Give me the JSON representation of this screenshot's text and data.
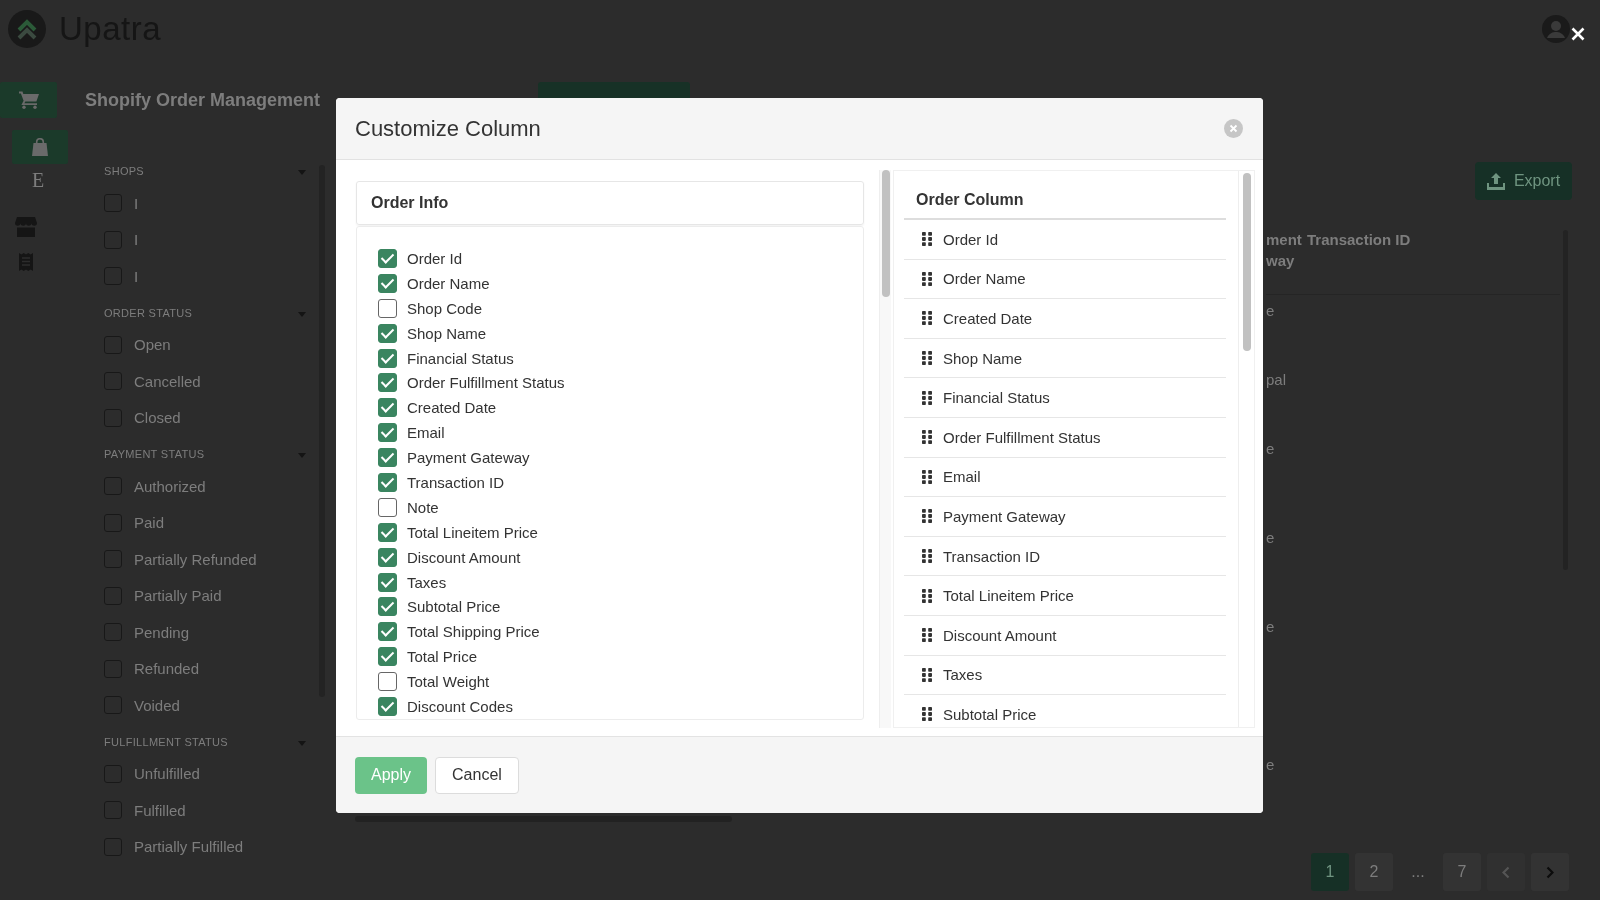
{
  "app": {
    "name": "Upatra"
  },
  "rail": [
    {
      "selected": true
    },
    {
      "selected": true
    },
    {
      "label": "E",
      "selected": false
    },
    {
      "selected": false
    },
    {
      "selected": false
    }
  ],
  "page": {
    "title": "Shopify Order Management",
    "export_button": "Export"
  },
  "filters": [
    {
      "heading": "SHOPS",
      "expanded": true,
      "options": [
        {
          "label": "I",
          "checked": false
        },
        {
          "label": "I",
          "checked": false
        },
        {
          "label": "I",
          "checked": false
        }
      ]
    },
    {
      "heading": "ORDER STATUS",
      "expanded": true,
      "options": [
        {
          "label": "Open",
          "checked": false
        },
        {
          "label": "Cancelled",
          "checked": false
        },
        {
          "label": "Closed",
          "checked": false
        }
      ]
    },
    {
      "heading": "PAYMENT STATUS",
      "expanded": true,
      "options": [
        {
          "label": "Authorized",
          "checked": false
        },
        {
          "label": "Paid",
          "checked": false
        },
        {
          "label": "Partially Refunded",
          "checked": false
        },
        {
          "label": "Partially Paid",
          "checked": false
        },
        {
          "label": "Pending",
          "checked": false
        },
        {
          "label": "Refunded",
          "checked": false
        },
        {
          "label": "Voided",
          "checked": false
        }
      ]
    },
    {
      "heading": "FULFILLMENT STATUS",
      "expanded": true,
      "options": [
        {
          "label": "Unfulfilled",
          "checked": false
        },
        {
          "label": "Fulfilled",
          "checked": false
        },
        {
          "label": "Partially Fulfilled",
          "checked": false
        }
      ]
    }
  ],
  "table": {
    "columns": [
      {
        "header": [
          "ment",
          "way"
        ]
      },
      {
        "header": [
          "Transaction ID"
        ]
      }
    ],
    "rows": [
      {
        "column_1": "e"
      },
      {
        "column_1": "pal"
      },
      {
        "column_1": "e"
      },
      {
        "column_1": "e"
      },
      {
        "column_1": "e"
      },
      {
        "column_1": "e"
      }
    ]
  },
  "pagination": {
    "pages": [
      {
        "kind": "page",
        "label": "1",
        "selected": true
      },
      {
        "kind": "page",
        "label": "2",
        "selected": false
      },
      {
        "kind": "ellipsis",
        "label": "...",
        "selected": false
      },
      {
        "kind": "page",
        "label": "7",
        "selected": false
      }
    ],
    "previous": {
      "disabled": true
    },
    "next": {
      "disabled": false
    }
  },
  "modal": {
    "title": "Customize Column",
    "left_panel": {
      "title": "Order Info",
      "fields": [
        {
          "label": "Order Id",
          "checked": true
        },
        {
          "label": "Order Name",
          "checked": true
        },
        {
          "label": "Shop Code",
          "checked": false
        },
        {
          "label": "Shop Name",
          "checked": true
        },
        {
          "label": "Financial Status",
          "checked": true
        },
        {
          "label": "Order Fulfillment Status",
          "checked": true
        },
        {
          "label": "Created Date",
          "checked": true
        },
        {
          "label": "Email",
          "checked": true
        },
        {
          "label": "Payment Gateway",
          "checked": true
        },
        {
          "label": "Transaction ID",
          "checked": true
        },
        {
          "label": "Note",
          "checked": false
        },
        {
          "label": "Total Lineitem Price",
          "checked": true
        },
        {
          "label": "Discount Amount",
          "checked": true
        },
        {
          "label": "Taxes",
          "checked": true
        },
        {
          "label": "Subtotal Price",
          "checked": true
        },
        {
          "label": "Total Shipping Price",
          "checked": true
        },
        {
          "label": "Total Price",
          "checked": true
        },
        {
          "label": "Total Weight",
          "checked": false
        },
        {
          "label": "Discount Codes",
          "checked": true
        }
      ]
    },
    "right_panel": {
      "title": "Order Column",
      "columns": [
        "Order Id",
        "Order Name",
        "Created Date",
        "Shop Name",
        "Financial Status",
        "Order Fulfillment Status",
        "Email",
        "Payment Gateway",
        "Transaction ID",
        "Total Lineitem Price",
        "Discount Amount",
        "Taxes",
        "Subtotal Price"
      ]
    },
    "buttons": [
      {
        "label": "Apply",
        "kind": "primary"
      },
      {
        "label": "Cancel",
        "kind": "secondary"
      }
    ]
  }
}
